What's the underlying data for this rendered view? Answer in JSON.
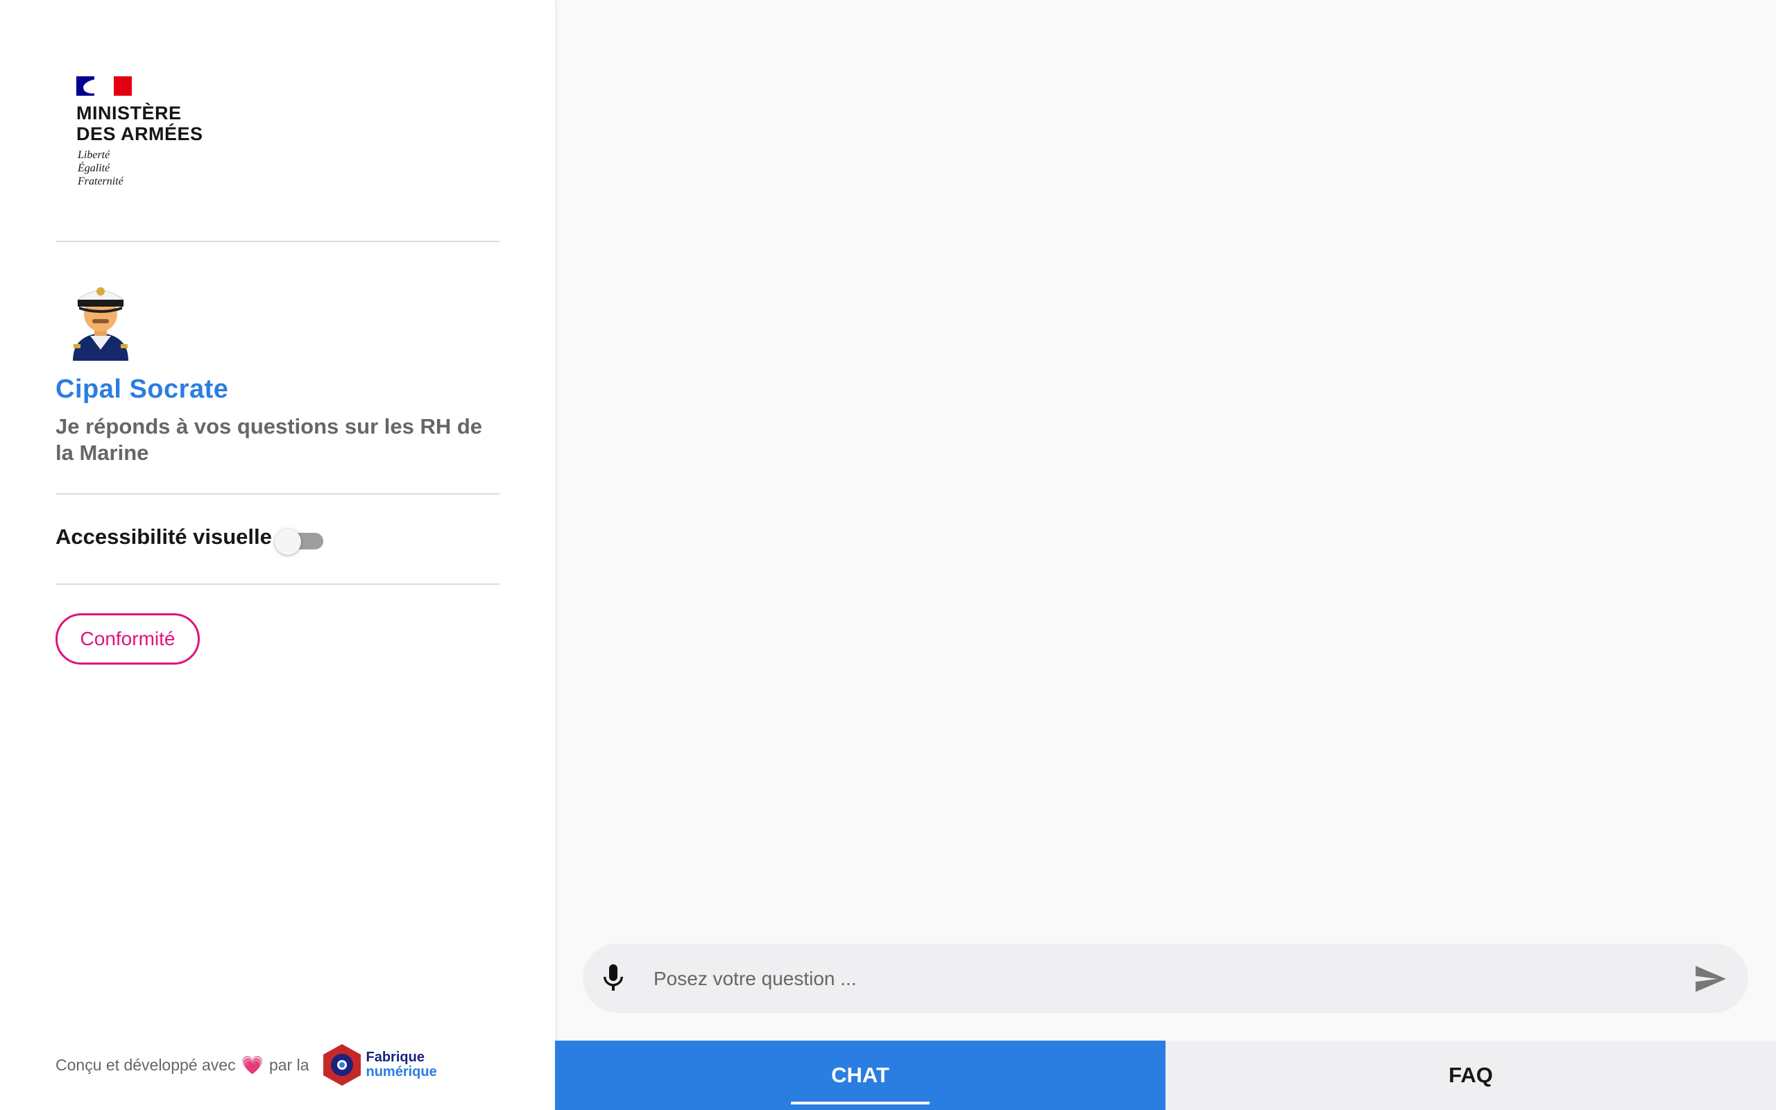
{
  "sidebar": {
    "logo": {
      "title_line1": "MINISTÈRE",
      "title_line2": "DES ARMÉES",
      "motto_line1": "Liberté",
      "motto_line2": "Égalité",
      "motto_line3": "Fraternité"
    },
    "bot": {
      "name": "Cipal Socrate",
      "description": "Je réponds à vos questions sur les RH de la Marine"
    },
    "accessibility": {
      "label": "Accessibilité visuelle",
      "enabled": false
    },
    "conformity_button": "Conformité",
    "footer": {
      "text_before": "Conçu et développé avec",
      "heart": "💗",
      "text_after": "par la",
      "partner_line1": "Fabrique",
      "partner_line2": "numérique"
    }
  },
  "chat": {
    "input_placeholder": "Posez votre question ...",
    "tabs": [
      {
        "label": "CHAT",
        "active": true
      },
      {
        "label": "FAQ",
        "active": false
      }
    ]
  },
  "colors": {
    "accent": "#2a7de1",
    "button_border": "#e1127d",
    "flag_blue": "#000091",
    "flag_red": "#e1000f"
  },
  "icons": [
    "marianne-logo",
    "sailor-avatar",
    "microphone-icon",
    "send-icon",
    "fabrique-numerique-logo"
  ]
}
